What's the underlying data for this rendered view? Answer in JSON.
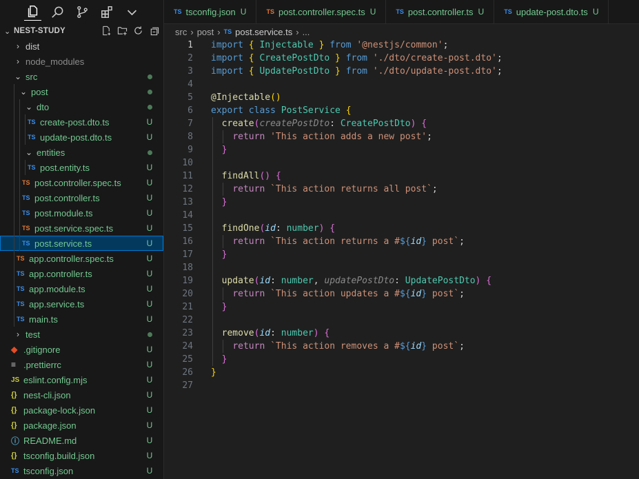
{
  "sidebar": {
    "section_title": "NEST-STUDY",
    "tree": [
      {
        "name": "dist",
        "icon": "chevron-right",
        "kind": "folder",
        "open": false
      },
      {
        "name": "node_modules",
        "kind": "folder",
        "open": false
      },
      {
        "name": "src",
        "kind": "folder",
        "open": true
      },
      {
        "name": "post",
        "kind": "folder",
        "open": true
      },
      {
        "name": "dto",
        "kind": "folder",
        "open": true
      },
      {
        "name": "create-post.dto.ts",
        "badge": "U"
      },
      {
        "name": "update-post.dto.ts",
        "badge": "U"
      },
      {
        "name": "entities",
        "kind": "folder",
        "open": true
      },
      {
        "name": "post.entity.ts",
        "badge": "U"
      },
      {
        "name": "post.controller.spec.ts",
        "badge": "U"
      },
      {
        "name": "post.controller.ts",
        "badge": "U"
      },
      {
        "name": "post.module.ts",
        "badge": "U"
      },
      {
        "name": "post.service.spec.ts",
        "badge": "U"
      },
      {
        "name": "post.service.ts",
        "badge": "U",
        "selected": true
      },
      {
        "name": "app.controller.spec.ts",
        "badge": "U"
      },
      {
        "name": "app.controller.ts",
        "badge": "U"
      },
      {
        "name": "app.module.ts",
        "badge": "U"
      },
      {
        "name": "app.service.ts",
        "badge": "U"
      },
      {
        "name": "main.ts",
        "badge": "U"
      },
      {
        "name": "test",
        "kind": "folder",
        "open": false
      },
      {
        "name": ".gitignore",
        "badge": "U"
      },
      {
        "name": ".prettierrc",
        "badge": "U"
      },
      {
        "name": "eslint.config.mjs",
        "badge": "U"
      },
      {
        "name": "nest-cli.json",
        "badge": "U"
      },
      {
        "name": "package-lock.json",
        "badge": "U"
      },
      {
        "name": "package.json",
        "badge": "U"
      },
      {
        "name": "README.md",
        "badge": "U"
      },
      {
        "name": "tsconfig.build.json",
        "badge": "U"
      },
      {
        "name": "tsconfig.json",
        "badge": "U"
      }
    ],
    "icon_labels": {
      "ts": "TS",
      "js": "JS",
      "json": "{}"
    }
  },
  "tabs": [
    {
      "label": "tsconfig.json",
      "status": "U"
    },
    {
      "label": "post.controller.spec.ts",
      "status": "U"
    },
    {
      "label": "post.controller.ts",
      "status": "U"
    },
    {
      "label": "update-post.dto.ts",
      "status": "U"
    }
  ],
  "breadcrumb": {
    "parts": [
      "src",
      "post",
      "post.service.ts",
      "..."
    ]
  },
  "editor": {
    "line_numbers": [
      "1",
      "2",
      "3",
      "4",
      "5",
      "6",
      "7",
      "8",
      "9",
      "10",
      "11",
      "12",
      "13",
      "14",
      "15",
      "16",
      "17",
      "18",
      "19",
      "20",
      "21",
      "22",
      "23",
      "24",
      "25",
      "26",
      "27"
    ],
    "current_line": "1",
    "lines": [
      "import { Injectable } from '@nestjs/common';",
      "import { CreatePostDto } from './dto/create-post.dto';",
      "import { UpdatePostDto } from './dto/update-post.dto';",
      "",
      "@Injectable()",
      "export class PostService {",
      "  create(createPostDto: CreatePostDto) {",
      "    return 'This action adds a new post';",
      "  }",
      "",
      "  findAll() {",
      "    return `This action returns all post`;",
      "  }",
      "",
      "  findOne(id: number) {",
      "    return `This action returns a #${id} post`;",
      "  }",
      "",
      "  update(id: number, updatePostDto: UpdatePostDto) {",
      "    return `This action updates a #${id} post`;",
      "  }",
      "",
      "  remove(id: number) {",
      "    return `This action removes a #${id} post`;",
      "  }",
      "}",
      ""
    ]
  },
  "colors": {
    "accent": "#0078d4",
    "untracked": "#73c991",
    "selection": "#04395e"
  }
}
